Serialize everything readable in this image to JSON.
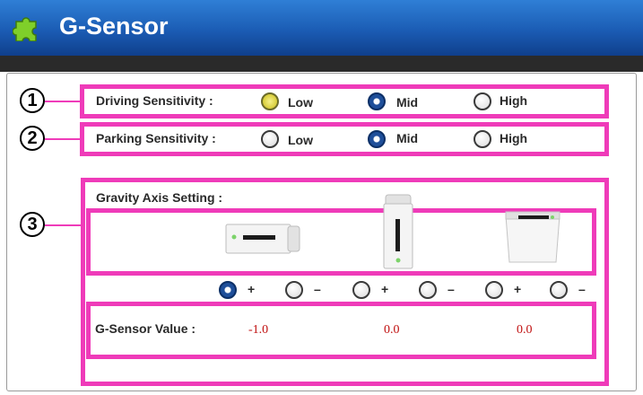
{
  "window": {
    "title": "G-Sensor"
  },
  "markers": [
    "1",
    "2",
    "3"
  ],
  "driving": {
    "label": "Driving Sensitivity :",
    "options": [
      "Low",
      "Mid",
      "High"
    ],
    "selected": "Mid"
  },
  "parking": {
    "label": "Parking Sensitivity :",
    "options": [
      "Low",
      "Mid",
      "High"
    ],
    "selected": "Mid"
  },
  "gravity": {
    "label": "Gravity Axis Setting :",
    "device_icons": [
      "device-horizontal-icon",
      "device-vertical-icon",
      "device-flat-icon"
    ],
    "axis_options": [
      "+",
      "–",
      "+",
      "–",
      "+",
      "–"
    ],
    "selected_index": 0
  },
  "gsensor": {
    "label": "G-Sensor Value :",
    "values": [
      "-1.0",
      "0.0",
      "0.0"
    ]
  },
  "colors": {
    "annotation": "#ef3bb9",
    "title_bar": "#1b5cb4",
    "value_text": "#c01010",
    "radio_selected": "#1f4f9a",
    "radio_hover": "#d8cd3a"
  }
}
